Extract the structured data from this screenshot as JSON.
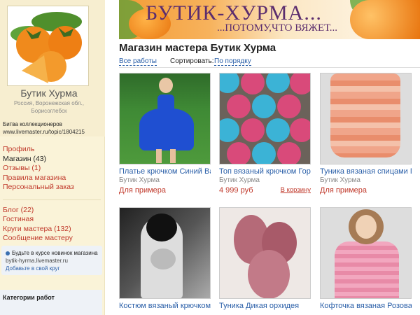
{
  "shop": {
    "name": "Бутик Хурма",
    "location": "Россия, Воронежская обл., Борисоглебск"
  },
  "contest": {
    "label": "Битва коллекционеров",
    "url": "www.livemaster.ru/topic/1804215"
  },
  "menu": {
    "group1": [
      {
        "label": "Профиль"
      },
      {
        "label": "Магазин (43)"
      },
      {
        "label": "Отзывы (1)"
      },
      {
        "label": "Правила магазина"
      },
      {
        "label": "Персональный заказ"
      }
    ],
    "group2": [
      {
        "label": "Блог (22)"
      },
      {
        "label": "Гостиная"
      },
      {
        "label": "Круги мастера (132)"
      },
      {
        "label": "Сообщение мастеру"
      }
    ]
  },
  "follow": {
    "text": "Будьте в курсе новинок магазина",
    "address": "bytik-hyrma.livemaster.ru",
    "add_label": "Добавьте в свой круг"
  },
  "categories": {
    "label": "Категории работ"
  },
  "banner": {
    "title": "БУТИК-ХУРМА...",
    "subtitle": "...ПОТОМУ,ЧТО ВЯЖЕТ..."
  },
  "page": {
    "heading": "Магазин мастера Бутик Хурма",
    "all_works": "Все работы",
    "sort_label": "Сортировать:",
    "sort_value": "По порядку"
  },
  "products": [
    {
      "title": "Платье крючком Синий Ва",
      "author": "Бутик Хурма",
      "price": "Для примера",
      "cart": ""
    },
    {
      "title": "Топ вязаный крючком Гор",
      "author": "Бутик Хурма",
      "price": "4 999 руб",
      "cart": "В корзину"
    },
    {
      "title": "Туника вязаная спицами Г",
      "author": "Бутик Хурма",
      "price": "Для примера",
      "cart": ""
    },
    {
      "title": "Костюм вязаный крючком",
      "author": "",
      "price": "",
      "cart": ""
    },
    {
      "title": "Туника Дикая орхидея",
      "author": "",
      "price": "",
      "cart": ""
    },
    {
      "title": "Кофточка вязаная Розова",
      "author": "",
      "price": "",
      "cart": ""
    }
  ],
  "colors": {
    "accent_link": "#2a5fa8",
    "menu_red": "#c0392b",
    "sidebar_bg": "#faf3d8"
  }
}
